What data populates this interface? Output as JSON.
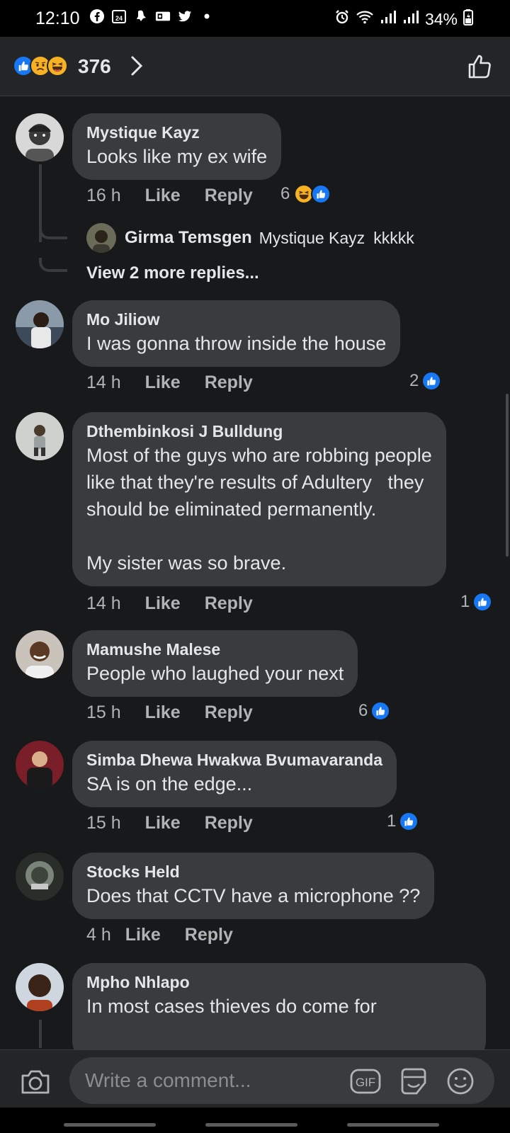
{
  "status": {
    "time": "12:10",
    "battery": "34%",
    "icons": [
      "facebook-icon",
      "calendar-icon",
      "notification-icon",
      "outlook-icon",
      "twitter-icon",
      "dot-icon"
    ],
    "calendar_day": "24"
  },
  "header": {
    "reactions": [
      "like",
      "sad",
      "haha"
    ],
    "count": "376"
  },
  "comments": [
    {
      "name": "Mystique Kayz",
      "text": "Looks like my ex wife",
      "time": "16 h",
      "like": "Like",
      "reply": "Reply",
      "reaction_count": "6",
      "reactions": [
        "haha",
        "like"
      ],
      "replies": {
        "name": "Girma Temsgen",
        "tag": "Mystique Kayz",
        "text": "kkkkk",
        "view_more": "View 2 more replies..."
      }
    },
    {
      "name": "Mo Jiliow",
      "text": "I was gonna throw inside the house",
      "time": "14 h",
      "like": "Like",
      "reply": "Reply",
      "reaction_count": "2",
      "reactions": [
        "like"
      ]
    },
    {
      "name": "Dthembinkosi J Bulldung",
      "text": "Most of the guys who are robbing people\nlike that they're results of Adultery   they\nshould be eliminated permanently.\n\nMy sister was so brave.",
      "time": "14 h",
      "like": "Like",
      "reply": "Reply",
      "reaction_count": "1",
      "reactions": [
        "like"
      ]
    },
    {
      "name": "Mamushe Malese",
      "text": "People who laughed your next",
      "time": "15 h",
      "like": "Like",
      "reply": "Reply",
      "reaction_count": "6",
      "reactions": [
        "like"
      ]
    },
    {
      "name": "Simba Dhewa Hwakwa Bvumavaranda",
      "text": "SA is on the edge...",
      "time": "15 h",
      "like": "Like",
      "reply": "Reply",
      "reaction_count": "1",
      "reactions": [
        "like"
      ]
    },
    {
      "name": "Stocks Held",
      "text": "Does that CCTV have a microphone ??",
      "time": "4 h",
      "like": "Like",
      "reply": "Reply",
      "reaction_count": "",
      "reactions": []
    },
    {
      "name": "Mpho Nhlapo",
      "text": "In most cases thieves do come for",
      "time": "",
      "like": "",
      "reply": "",
      "reaction_count": "",
      "reactions": []
    }
  ],
  "composer": {
    "placeholder": "Write a comment...",
    "gif_label": "GIF"
  },
  "colors": {
    "background": "#18191a",
    "bubble": "#3a3b3c",
    "like_blue": "#1877f2",
    "haha_yellow": "#f7b125",
    "text": "#e4e6eb",
    "muted": "#b0b3b8"
  }
}
